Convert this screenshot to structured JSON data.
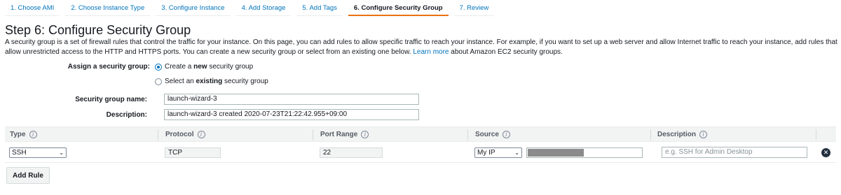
{
  "tabs": [
    {
      "label": "1. Choose AMI"
    },
    {
      "label": "2. Choose Instance Type"
    },
    {
      "label": "3. Configure Instance"
    },
    {
      "label": "4. Add Storage"
    },
    {
      "label": "5. Add Tags"
    },
    {
      "label": "6. Configure Security Group"
    },
    {
      "label": "7. Review"
    }
  ],
  "active_tab": "6. Configure Security Group",
  "page": {
    "title": "Step 6: Configure Security Group",
    "description": "A security group is a set of firewall rules that control the traffic for your instance. On this page, you can add rules to allow specific traffic to reach your instance. For example, if you want to set up a web server and allow Internet traffic to reach your instance, add rules that allow unrestricted access to the HTTP and HTTPS ports. You can create a new security group or select from an existing one below.",
    "learn_more": "Learn more",
    "description_suffix": "about Amazon EC2 security groups."
  },
  "assign": {
    "label": "Assign a security group:",
    "option_new_prefix": "Create a ",
    "option_new_bold": "new",
    "option_new_suffix": " security group",
    "option_existing_prefix": "Select an ",
    "option_existing_bold": "existing",
    "option_existing_suffix": " security group",
    "selected": "new"
  },
  "form": {
    "name_label": "Security group name:",
    "name_value": "launch-wizard-3",
    "description_label": "Description:",
    "description_value": "launch-wizard-3 created 2020-07-23T21:22:42.955+09:00"
  },
  "table": {
    "headers": [
      "Type",
      "Protocol",
      "Port Range",
      "Source",
      "Description"
    ],
    "rows": [
      {
        "type": "SSH",
        "protocol": "TCP",
        "port_range": "22",
        "source": "My IP",
        "description_placeholder": "e.g. SSH for Admin Desktop"
      }
    ]
  },
  "buttons": {
    "add_rule": "Add Rule",
    "remove": "✕"
  },
  "icons": {
    "info": "info-icon",
    "remove": "remove-rule-icon",
    "dropdown": "chevron-down-icon"
  },
  "colors": {
    "link": "#0073bb",
    "active_tab_underline": "#ec7211",
    "table_header_bg": "#f2f3f3"
  }
}
